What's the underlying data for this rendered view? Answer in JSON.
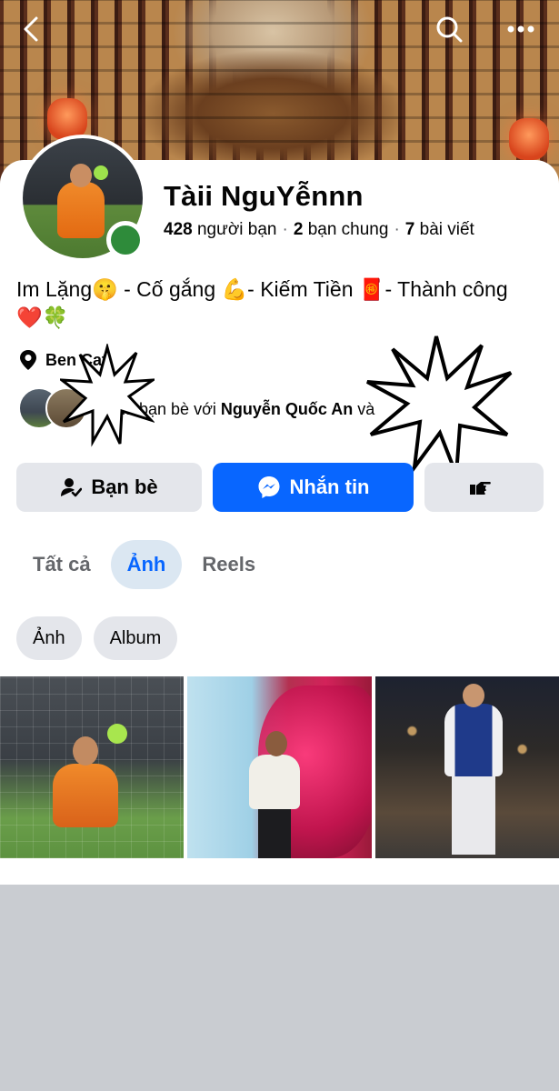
{
  "profile": {
    "name": "Tàii NguYễnnn",
    "stats": {
      "friends_count": "428",
      "friends_label": "người bạn",
      "mutual_count": "2",
      "mutual_label": "bạn chung",
      "posts_count": "7",
      "posts_label": "bài viết",
      "separator": "·"
    },
    "bio_line1": "Im Lặng🤫 - Cố gắng 💪- Kiếm Tiền 🧧- Thành công",
    "bio_line2": "❤️🍀",
    "location": "Ben Cat",
    "mutual_prefix": "là bạn bè với",
    "mutual_name": "Nguyễn Quốc An",
    "mutual_suffix": "và"
  },
  "actions": {
    "friends_label": "Bạn bè",
    "message_label": "Nhắn tin"
  },
  "tabs": [
    {
      "label": "Tất cả",
      "active": false
    },
    {
      "label": "Ảnh",
      "active": true
    },
    {
      "label": "Reels",
      "active": false
    }
  ],
  "chips": [
    "Ảnh",
    "Album"
  ],
  "icons": {
    "back": "chevron-left-icon",
    "search": "search-icon",
    "more": "more-icon",
    "location": "location-pin-icon",
    "friends": "friend-check-icon",
    "messenger": "messenger-icon",
    "poke": "poke-hand-icon"
  },
  "colors": {
    "accent": "#0866ff",
    "button_gray": "#e4e6eb",
    "online": "#2e8b3a",
    "active_tab_bg": "#dbe7f2"
  }
}
